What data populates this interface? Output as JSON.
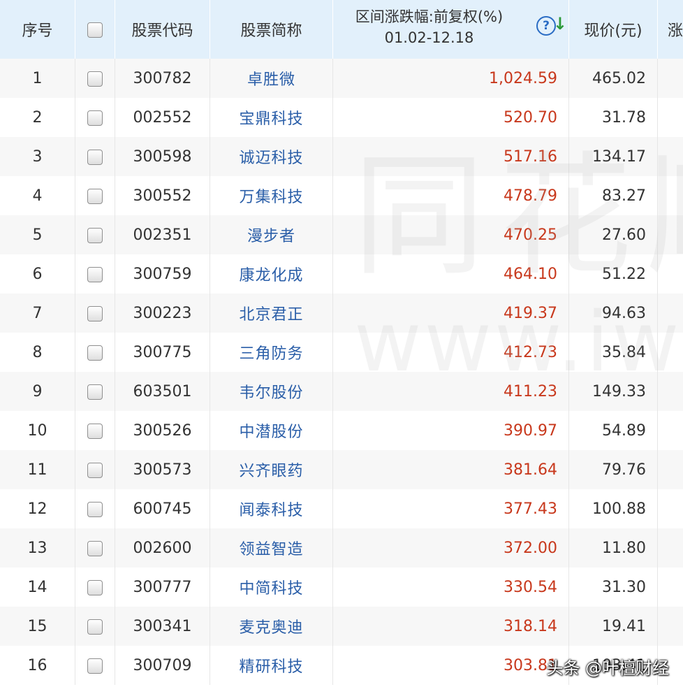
{
  "header": {
    "seq": "序号",
    "code": "股票代码",
    "name": "股票简称",
    "change_line1": "区间涨跌幅:前复权(%)",
    "change_line2": "01.02-12.18",
    "price": "现价(元)",
    "more": "涨"
  },
  "icons": {
    "help": "question-circle-icon",
    "sort": "arrow-down-icon"
  },
  "colors": {
    "header_bg": "#e2f0fb",
    "name_link": "#2a5ea8",
    "change_up": "#c8381c",
    "sort_arrow": "#2d9a3a",
    "help_icon": "#2a6cc4"
  },
  "rows": [
    {
      "seq": "1",
      "code": "300782",
      "name": "卓胜微",
      "change": "1,024.59",
      "price": "465.02"
    },
    {
      "seq": "2",
      "code": "002552",
      "name": "宝鼎科技",
      "change": "520.70",
      "price": "31.78"
    },
    {
      "seq": "3",
      "code": "300598",
      "name": "诚迈科技",
      "change": "517.16",
      "price": "134.17"
    },
    {
      "seq": "4",
      "code": "300552",
      "name": "万集科技",
      "change": "478.79",
      "price": "83.27"
    },
    {
      "seq": "5",
      "code": "002351",
      "name": "漫步者",
      "change": "470.25",
      "price": "27.60"
    },
    {
      "seq": "6",
      "code": "300759",
      "name": "康龙化成",
      "change": "464.10",
      "price": "51.22"
    },
    {
      "seq": "7",
      "code": "300223",
      "name": "北京君正",
      "change": "419.37",
      "price": "94.63"
    },
    {
      "seq": "8",
      "code": "300775",
      "name": "三角防务",
      "change": "412.73",
      "price": "35.84"
    },
    {
      "seq": "9",
      "code": "603501",
      "name": "韦尔股份",
      "change": "411.23",
      "price": "149.33"
    },
    {
      "seq": "10",
      "code": "300526",
      "name": "中潜股份",
      "change": "390.97",
      "price": "54.89"
    },
    {
      "seq": "11",
      "code": "300573",
      "name": "兴齐眼药",
      "change": "381.64",
      "price": "79.76"
    },
    {
      "seq": "12",
      "code": "600745",
      "name": "闻泰科技",
      "change": "377.43",
      "price": "100.88"
    },
    {
      "seq": "13",
      "code": "002600",
      "name": "领益智造",
      "change": "372.00",
      "price": "11.80"
    },
    {
      "seq": "14",
      "code": "300777",
      "name": "中简科技",
      "change": "330.54",
      "price": "31.30"
    },
    {
      "seq": "15",
      "code": "300341",
      "name": "麦克奥迪",
      "change": "318.14",
      "price": "19.41"
    },
    {
      "seq": "16",
      "code": "300709",
      "name": "精研科技",
      "change": "303.81",
      "price": "103.41"
    }
  ],
  "watermark": {
    "chars": "同花顺",
    "url": "www.iwe"
  },
  "brand": "头条 @叶檀财经"
}
